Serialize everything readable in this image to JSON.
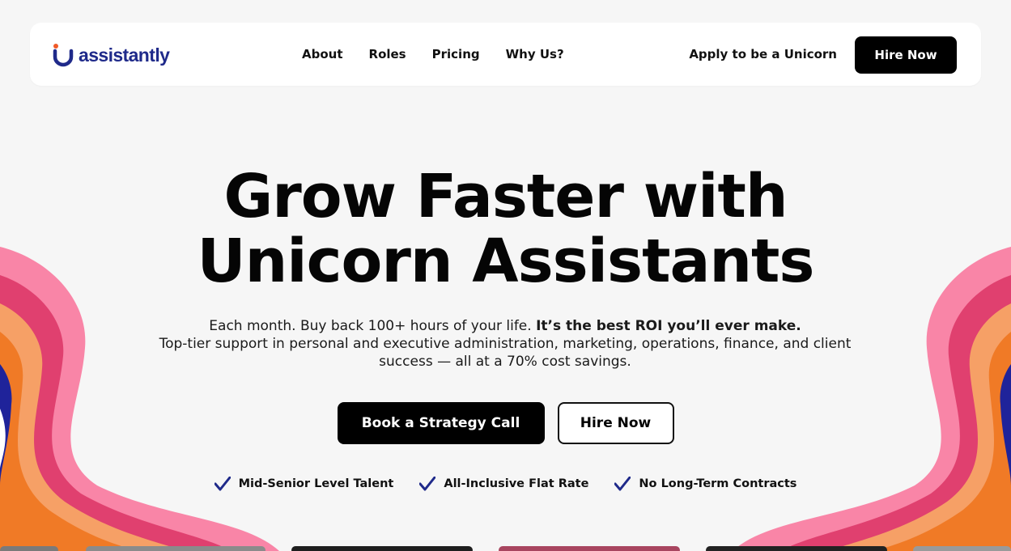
{
  "brand": {
    "name": "assistantly",
    "accent": "#1f2a8a",
    "dot_color": "#f05a28"
  },
  "nav": {
    "links": [
      "About",
      "Roles",
      "Pricing",
      "Why Us?"
    ],
    "apply_label": "Apply to be a Unicorn",
    "hire_label": "Hire Now"
  },
  "hero": {
    "headline_line1": "Grow Faster with",
    "headline_line2": "Unicorn Assistants",
    "sub_line1_plain": "Each month. Buy back 100+ hours of your life.",
    "sub_line1_bold": "It’s the best ROI you’ll ever make.",
    "sub_line2": "Top-tier support in personal and executive administration, marketing, operations, finance, and client success — all at a 70% cost savings.",
    "primary_cta": "Book a Strategy Call",
    "secondary_cta": "Hire Now"
  },
  "features": [
    "Mid-Senior Level Talent",
    "All-Inclusive Flat Rate",
    "No Long-Term Contracts"
  ],
  "colors": {
    "background": "#f6f6f6",
    "wave_pink": "#f985a7",
    "wave_magenta": "#e0406f",
    "wave_peach": "#f6a066",
    "wave_orange": "#f07a26",
    "wave_navy": "#1f239a",
    "check_color": "#1f2a8a"
  },
  "icons": [
    "brand-logo-icon",
    "check-icon"
  ]
}
